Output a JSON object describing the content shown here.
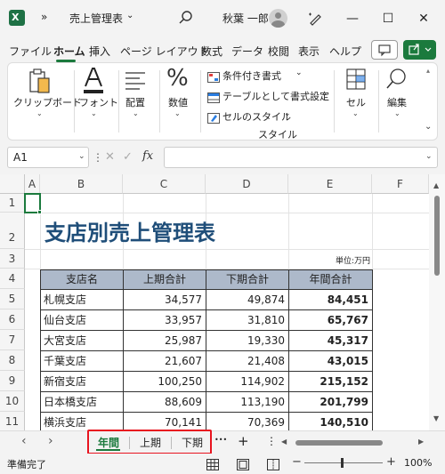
{
  "titlebar": {
    "app_icon": "excel-icon",
    "overflow": "»",
    "file_title": "売上管理表",
    "user_name": "秋葉 一郎",
    "minimize": "—",
    "maximize": "☐",
    "close": "✕"
  },
  "menu": {
    "items": [
      "ファイル",
      "ホーム",
      "挿入",
      "ページ レイアウト",
      "数式",
      "データ",
      "校閲",
      "表示",
      "ヘルプ"
    ],
    "active": "ホーム"
  },
  "ribbon": {
    "clipboard": "クリップボード",
    "font": "フォント",
    "alignment": "配置",
    "number": "数値",
    "conditional": "条件付き書式",
    "table_format": "テーブルとして書式設定",
    "cell_style": "セルのスタイル",
    "style_group": "スタイル",
    "cells": "セル",
    "edit": "編集",
    "percent_glyph": "%"
  },
  "formula": {
    "namebox": "A1",
    "fx": "fx",
    "value": ""
  },
  "grid": {
    "columns": [
      "A",
      "B",
      "C",
      "D",
      "E",
      "F"
    ],
    "rows": [
      "1",
      "2",
      "3",
      "4",
      "5",
      "6",
      "7",
      "8",
      "9",
      "10",
      "11"
    ],
    "title": "支店別売上管理表",
    "unit": "単位:万円",
    "headers": [
      "支店名",
      "上期合計",
      "下期合計",
      "年間合計"
    ],
    "data": [
      [
        "札幌支店",
        "34,577",
        "49,874",
        "84,451"
      ],
      [
        "仙台支店",
        "33,957",
        "31,810",
        "65,767"
      ],
      [
        "大宮支店",
        "25,987",
        "19,330",
        "45,317"
      ],
      [
        "千葉支店",
        "21,607",
        "21,408",
        "43,015"
      ],
      [
        "新宿支店",
        "100,250",
        "114,902",
        "215,152"
      ],
      [
        "日本橋支店",
        "88,609",
        "113,190",
        "201,799"
      ],
      [
        "横浜支店",
        "70,141",
        "70,369",
        "140,510"
      ]
    ]
  },
  "tabs": {
    "sheets": [
      "年間",
      "上期",
      "下期"
    ],
    "active": "年間",
    "more": "•••",
    "add": "+",
    "options": "⋮"
  },
  "status": {
    "ready": "準備完了",
    "zoom": "100%"
  },
  "colors": {
    "accent": "#1b7a3d",
    "title_blue": "#1f4e79",
    "header_fill": "#adb9ca",
    "highlight_red": "#e8141f"
  }
}
